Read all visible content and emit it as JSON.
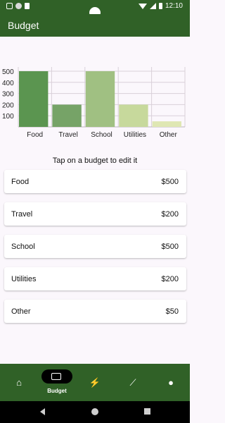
{
  "status": {
    "time": "12:10"
  },
  "app": {
    "title": "Budget"
  },
  "hint": "Tap on a budget to edit it",
  "budgets": [
    {
      "name": "Food",
      "amount": "$500"
    },
    {
      "name": "Travel",
      "amount": "$200"
    },
    {
      "name": "School",
      "amount": "$500"
    },
    {
      "name": "Utilities",
      "amount": "$200"
    },
    {
      "name": "Other",
      "amount": "$50"
    }
  ],
  "nav": {
    "items": [
      {
        "icon": "home-icon"
      },
      {
        "icon": "budget-icon",
        "label": "Budget",
        "selected": true
      },
      {
        "icon": "flash-off-icon"
      },
      {
        "icon": "trend-icon"
      },
      {
        "icon": "person-icon"
      }
    ]
  },
  "chart_data": {
    "type": "bar",
    "categories": [
      "Food",
      "Travel",
      "School",
      "Utilities",
      "Other"
    ],
    "values": [
      500,
      200,
      500,
      200,
      50
    ],
    "ylim": [
      0,
      500
    ],
    "yticks": [
      100,
      200,
      300,
      400,
      500
    ],
    "grid": true,
    "colors": [
      "#5b9550",
      "#76a367",
      "#a0c082",
      "#c7d99c",
      "#dfe7b3"
    ]
  }
}
